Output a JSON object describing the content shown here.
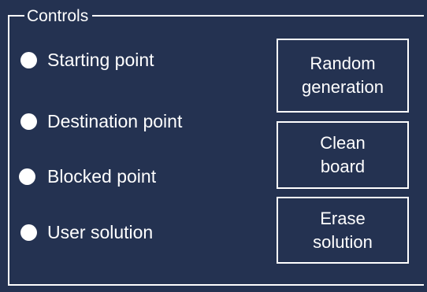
{
  "controls": {
    "title": "Controls",
    "radios": [
      {
        "label": "Starting point"
      },
      {
        "label": "Destination point"
      },
      {
        "label": "Blocked point"
      },
      {
        "label": "User solution"
      }
    ],
    "buttons": {
      "random": {
        "line1": "Random",
        "line2": "generation"
      },
      "clean": {
        "line1": "Clean",
        "line2": "board"
      },
      "erase": {
        "line1": "Erase",
        "line2": "solution"
      }
    }
  },
  "colors": {
    "background": "#243251",
    "foreground": "#ffffff"
  }
}
